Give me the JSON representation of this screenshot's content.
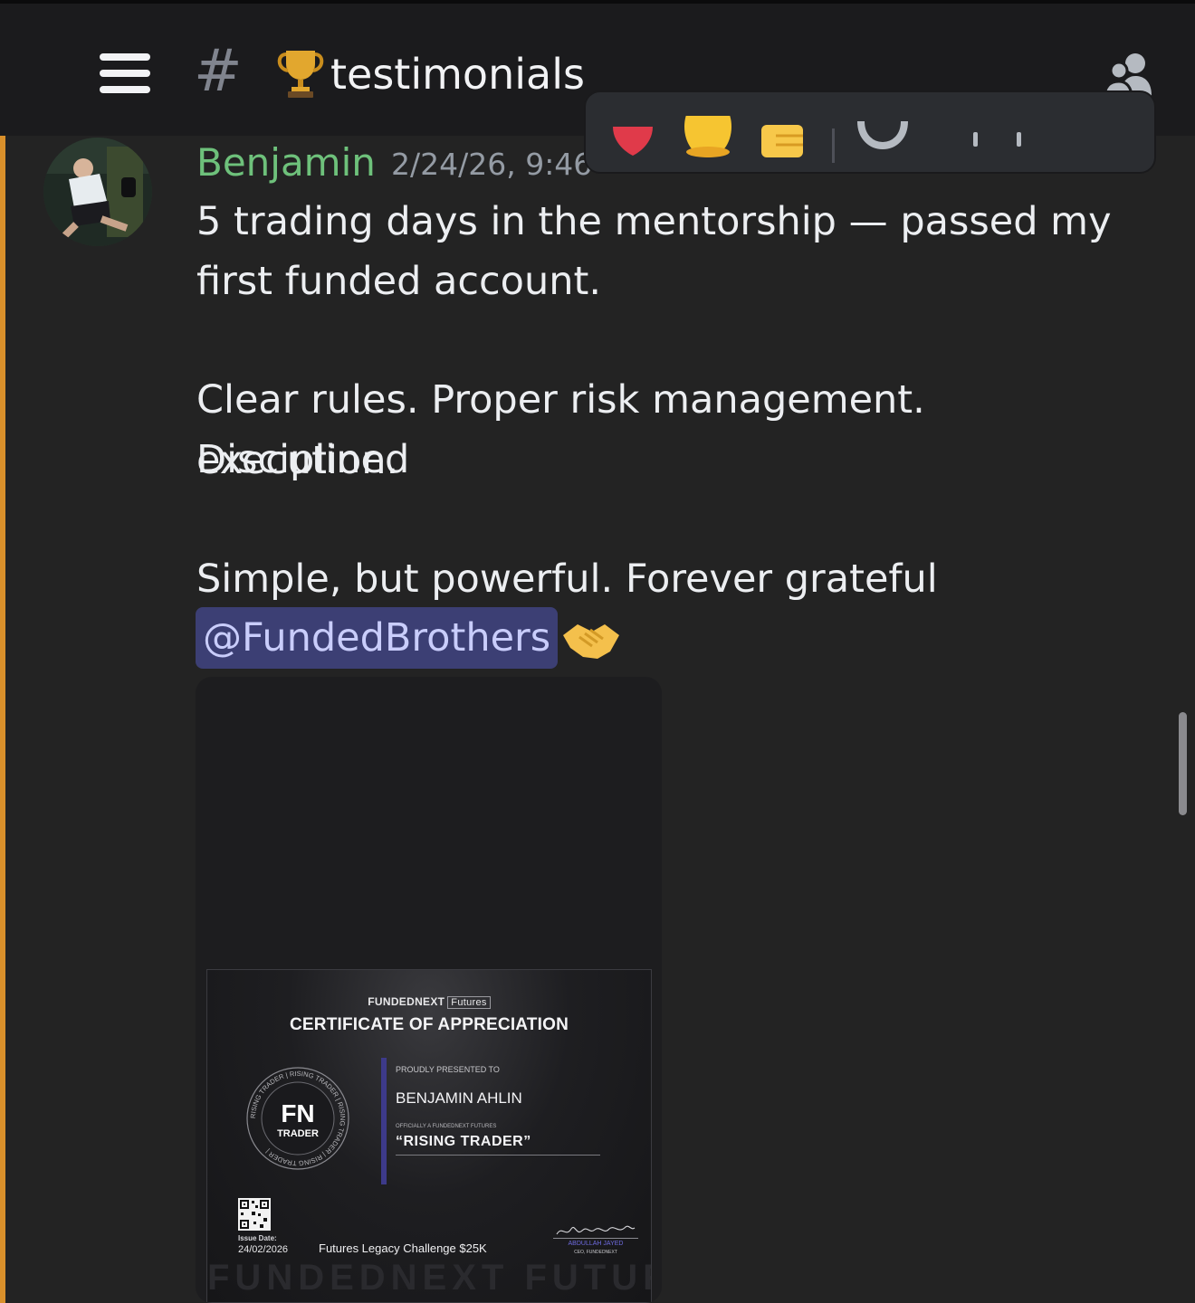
{
  "header": {
    "channel_prefix": "#",
    "channel_name": "testimonials",
    "channel_emoji": "trophy-icon",
    "menu_icon": "hamburger-menu-icon",
    "members_icon": "members-icon"
  },
  "reactions_bar": {
    "items": [
      "heart-icon",
      "smiling-face-icon",
      "thumbs-up-icon",
      "add-reaction-icon",
      "more-icon"
    ]
  },
  "message": {
    "author": "Benjamin",
    "timestamp": "2/24/26, 9:46",
    "lines": [
      "5 trading days in the mentorship — passed my",
      "first funded account.",
      "Clear rules. Proper risk management. Disciplined",
      "execution.",
      "Simple, but powerful. Forever grateful"
    ],
    "mention": "@FundedBrothers",
    "trailing_emoji": "handshake-icon",
    "author_color": "#6ec17b"
  },
  "certificate": {
    "brand": "FUNDEDNEXT",
    "brand_tag": "Futures",
    "title": "CERTIFICATE OF APPRECIATION",
    "seal_logo": "FN",
    "seal_label": "TRADER",
    "seal_ring_text": "RISING TRADER | RISING TRADER | RISING TRADER | RISING TRADER |",
    "presented_to_label": "PROUDLY PRESENTED TO",
    "recipient": "BENJAMIN AHLIN",
    "official_label": "OFFICIALLY A FUNDEDNEXT FUTURES",
    "rank": "“RISING TRADER”",
    "issue_label": "Issue Date:",
    "issue_date": "24/02/2026",
    "challenge": "Futures Legacy Challenge $25K",
    "signatory": "ABDULLAH JAYED",
    "signatory_role": "CEO, FUNDEDNEXT",
    "watermark": "FUNDEDNEXT FUTURES"
  },
  "colors": {
    "background": "#232323",
    "header": "#1b1b1d",
    "highlight_bar": "#d9902b",
    "mention_bg": "#3c3f74",
    "mention_text": "#c9cdfb"
  }
}
